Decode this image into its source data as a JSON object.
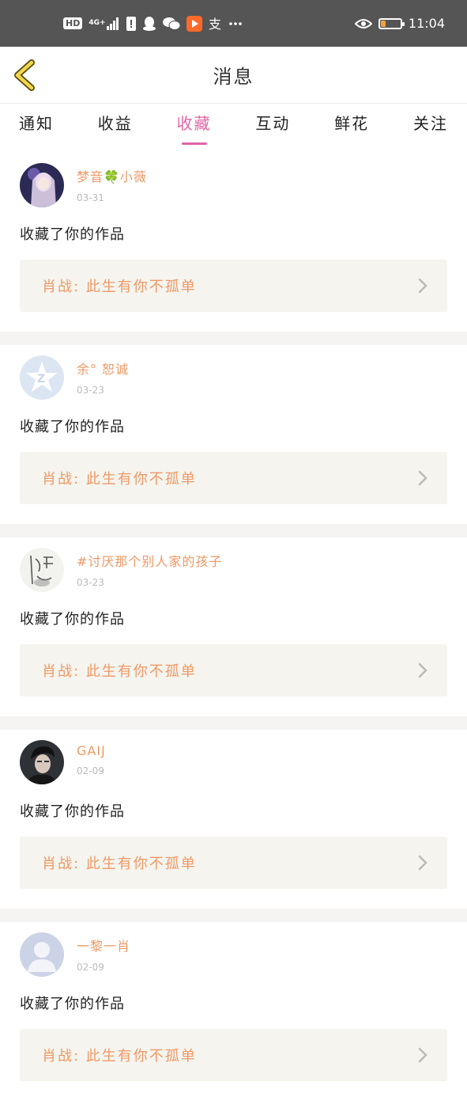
{
  "status_bar": {
    "hd": "HD",
    "network": "4G+",
    "time": "11:04",
    "battery_level": 0.25
  },
  "header": {
    "title": "消息"
  },
  "tabs": [
    {
      "label": "通知"
    },
    {
      "label": "收益"
    },
    {
      "label": "收藏"
    },
    {
      "label": "互动"
    },
    {
      "label": "鲜花"
    },
    {
      "label": "关注"
    }
  ],
  "active_tab": "收藏",
  "items": [
    {
      "user": "梦音🍀小薇",
      "date": "03-31",
      "action": "收藏了你的作品",
      "work": "肖战: 此生有你不孤单",
      "avatar": "photo-girl"
    },
    {
      "user": "余° 恕诚",
      "date": "03-23",
      "action": "收藏了你的作品",
      "work": "肖战: 此生有你不孤单",
      "avatar": "default-star"
    },
    {
      "user": "#讨厌那个别人家的孩子",
      "date": "03-23",
      "action": "收藏了你的作品",
      "work": "肖战: 此生有你不孤单",
      "avatar": "sketch"
    },
    {
      "user": "GAIJ",
      "date": "02-09",
      "action": "收藏了你的作品",
      "work": "肖战: 此生有你不孤单",
      "avatar": "photo-boy"
    },
    {
      "user": "一黎一肖",
      "date": "02-09",
      "action": "收藏了你的作品",
      "work": "肖战: 此生有你不孤单",
      "avatar": "default-person"
    }
  ],
  "colors": {
    "accent": "#e066a5",
    "username": "#ee9966",
    "work_bg": "#f5f4ee",
    "back_arrow": "#e8c830"
  }
}
